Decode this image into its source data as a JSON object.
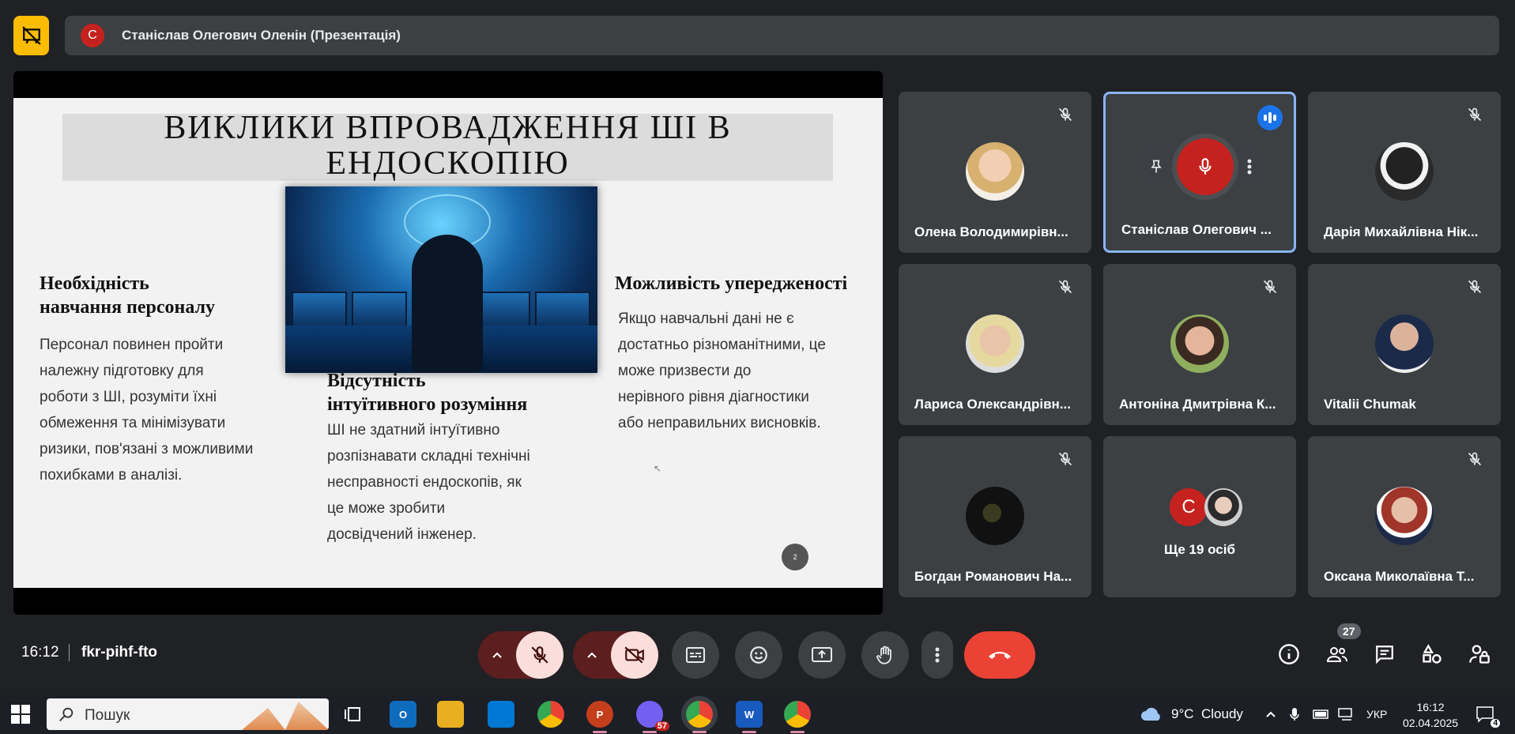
{
  "presenter": {
    "avatar_letter": "С",
    "title": "Станіслав Олегович Оленін (Презентація)"
  },
  "slide": {
    "title": "ВИКЛИКИ ВПРОВАДЖЕННЯ ШІ В ЕНДОСКОПІЮ",
    "columns": [
      {
        "heading_line1": "Необхідність",
        "heading_line2": "навчання персоналу",
        "lines": [
          "Персонал повинен пройти",
          "належну підготовку для",
          "роботи з ШІ, розуміти їхні",
          "обмеження та мінімізувати",
          "ризики, пов'язані з можливими",
          "похибками в аналізі."
        ]
      },
      {
        "heading_line1": "Відсутність",
        "heading_line2": "інтуїтивного розуміння",
        "lines": [
          "ШІ не здатний інтуїтивно",
          "розпізнавати складні технічні",
          "несправності ендоскопів, як",
          "це може зробити",
          "досвідчений інженер."
        ]
      },
      {
        "heading_line1": "Можливість упередженості",
        "lines": [
          "Якщо навчальні дані не є",
          "достатньо різноманітними, це",
          "може призвести до",
          "нерівного рівня діагностики",
          "або неправильних висновків."
        ]
      }
    ],
    "page_number": "2"
  },
  "participants": [
    {
      "name": "Олена Володимирівн...",
      "muted": true
    },
    {
      "name": "Станіслав Олегович ...",
      "muted": false,
      "speaking": true
    },
    {
      "name": "Дарія Михайлівна Нік...",
      "muted": true
    },
    {
      "name": "Лариса Олександрівн...",
      "muted": true
    },
    {
      "name": "Антоніна Дмитрівна К...",
      "muted": true
    },
    {
      "name": "Vitalii Chumak",
      "muted": true
    },
    {
      "name": "Богдан Романович На...",
      "muted": true
    },
    {
      "name": "Ще 19 осіб",
      "more_letter": "С"
    },
    {
      "name": "Оксана Миколаївна Т...",
      "muted": true
    }
  ],
  "bottom_bar": {
    "time": "16:12",
    "meeting_code": "fkr-pihf-fto",
    "people_count": "27"
  },
  "taskbar": {
    "search_placeholder": "Пошук",
    "viber_badge": "57",
    "weather": "9°C  Cloudy",
    "language": "УКР",
    "clock_time": "16:12",
    "clock_date": "02.04.2025",
    "notifications": "4"
  },
  "colors": {
    "background": "#202124",
    "tile": "#3c4043",
    "accent": "#8ab4f8",
    "hangup": "#ea4335",
    "muted_control": "#f9dedc",
    "logo": "#fbbc04"
  }
}
